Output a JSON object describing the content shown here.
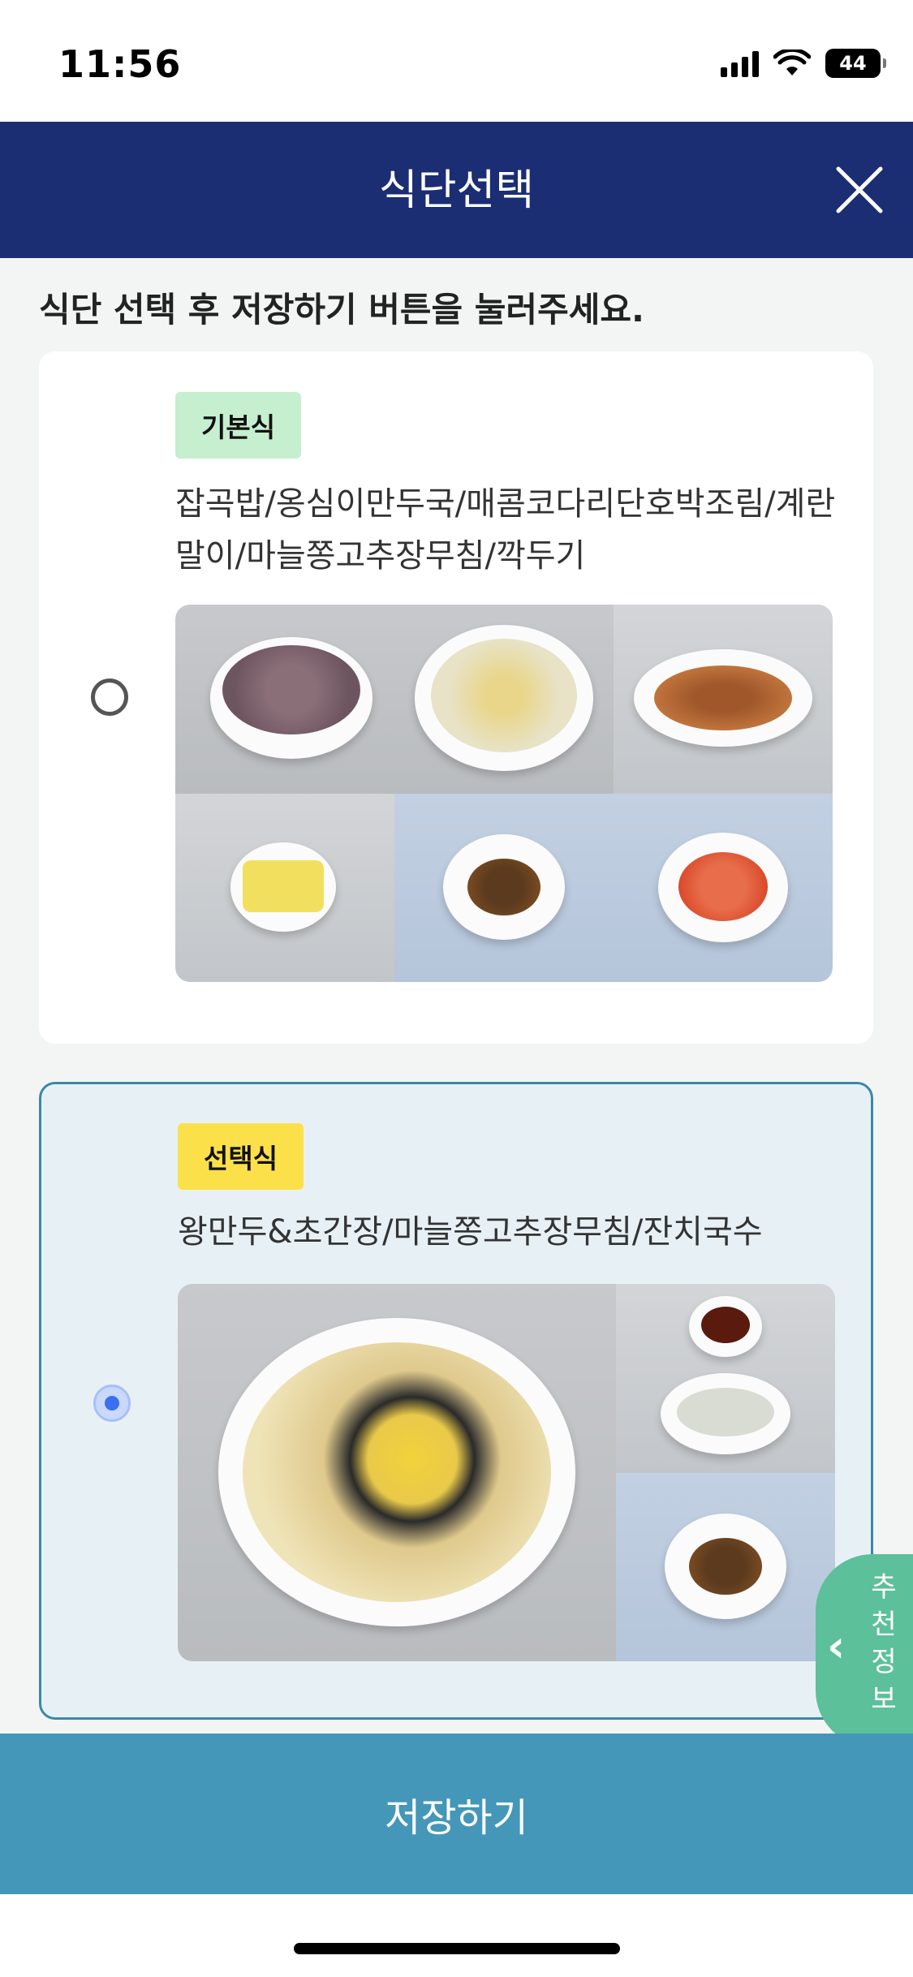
{
  "status_bar": {
    "time": "11:56",
    "battery": "44"
  },
  "header": {
    "title": "식단선택"
  },
  "instruction": "식단 선택 후 저장하기 버튼을 눌러주세요.",
  "meals": [
    {
      "badge": "기본식",
      "badge_color": "#c5efcf",
      "menu": "잡곡밥/옹심이만두국/매콤코다리단호박조림/계란말이/마늘쫑고추장무침/깍두기",
      "selected": false,
      "photos": [
        "mixed-grain-rice",
        "dumpling-soup",
        "braised-pollack-pumpkin",
        "rolled-omelette",
        "garlic-stem-gochujang",
        "kkakdugi"
      ]
    },
    {
      "badge": "선택식",
      "badge_color": "#fbe04a",
      "menu": "왕만두&초간장/마늘쫑고추장무침/잔치국수",
      "selected": true,
      "photos": [
        "janchi-guksu",
        "dumplings-soy-sauce",
        "garlic-stem-gochujang"
      ]
    }
  ],
  "side_tab": {
    "label": "추천정보"
  },
  "save_button": {
    "label": "저장하기"
  },
  "colors": {
    "header": "#1b2d73",
    "save": "#4497b8",
    "side_tab": "#5cc09a",
    "selected_border": "#3a89a8"
  }
}
